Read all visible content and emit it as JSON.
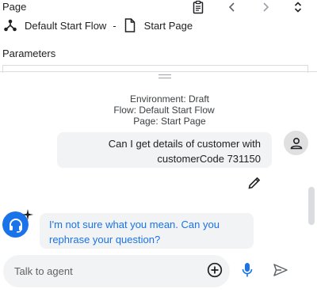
{
  "header": {
    "page_label": "Page",
    "flow_name": "Default Start Flow",
    "separator": "-",
    "page_name": "Start Page",
    "icons": [
      "clipboard-icon",
      "chevron-left-icon",
      "chevron-right-icon",
      "unfold-icon"
    ]
  },
  "parameters": {
    "label": "Parameters"
  },
  "simulator": {
    "environment_line": "Environment: Draft",
    "flow_line": "Flow: Default Start Flow",
    "page_line": "Page: Start Page",
    "messages": [
      {
        "role": "user",
        "text_line1": "Can I get details of customer with",
        "text_line2": "customerCode 731150"
      },
      {
        "role": "agent",
        "text_line1": "I'm not sure what you mean. Can you",
        "text_line2": "rephrase your question?"
      }
    ]
  },
  "input": {
    "placeholder": "Talk to agent",
    "value": ""
  },
  "colors": {
    "accent": "#1a73e8",
    "bubble_bg": "#f1f3f4",
    "icon": "#202124"
  }
}
